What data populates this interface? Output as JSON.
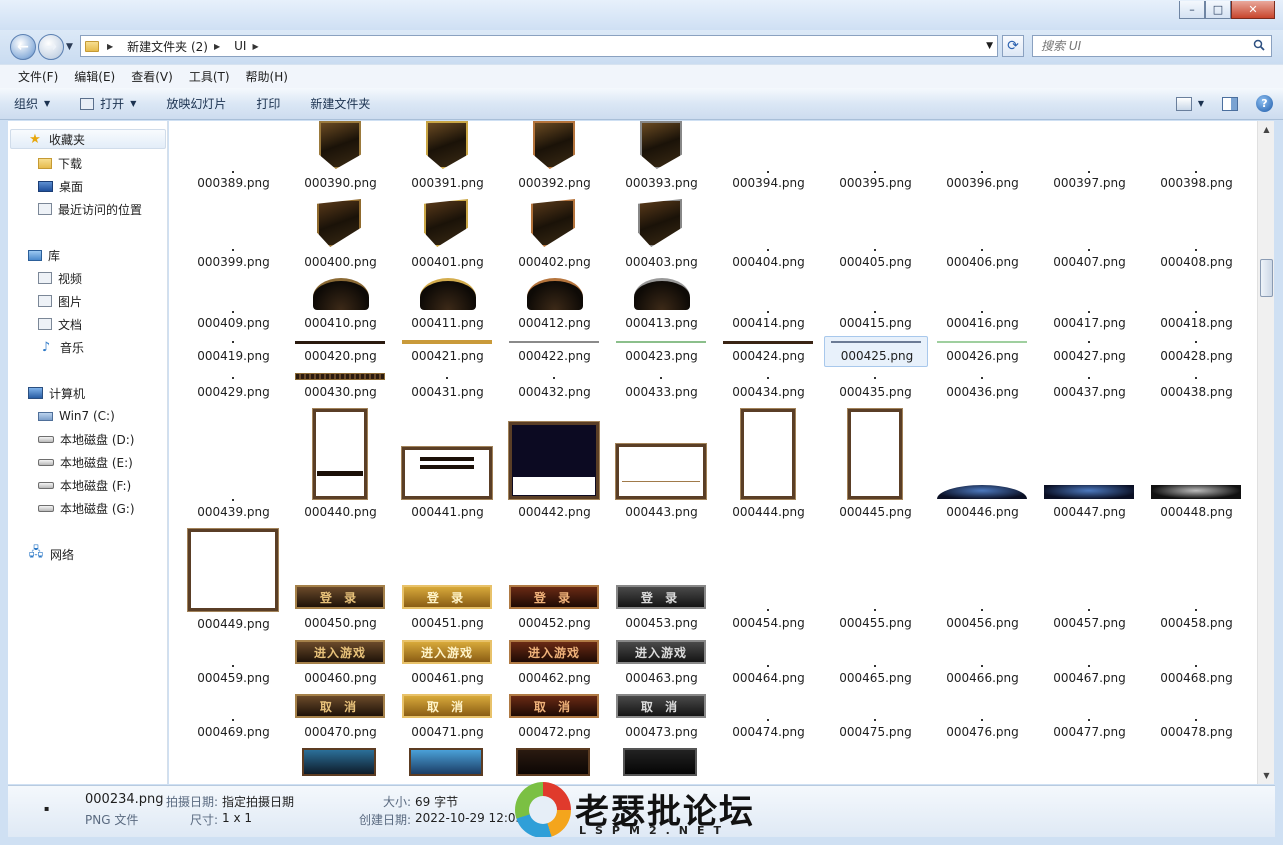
{
  "window": {
    "controls": {
      "minimize": "–",
      "maximize": "□",
      "close": "✕"
    }
  },
  "address": {
    "crumbs": [
      "新建文件夹 (2)",
      "UI"
    ],
    "search_placeholder": "搜索 UI"
  },
  "menu": [
    "文件(F)",
    "编辑(E)",
    "查看(V)",
    "工具(T)",
    "帮助(H)"
  ],
  "commands": {
    "organize": "组织",
    "open": "打开",
    "slideshow": "放映幻灯片",
    "print": "打印",
    "new_folder": "新建文件夹"
  },
  "nav": {
    "favorites": "收藏夹",
    "downloads": "下载",
    "desktop": "桌面",
    "recent": "最近访问的位置",
    "libraries": "库",
    "videos": "视频",
    "pictures": "图片",
    "documents": "文档",
    "music": "音乐",
    "computer": "计算机",
    "drives": [
      "Win7 (C:)",
      "本地磁盘 (D:)",
      "本地磁盘 (E:)",
      "本地磁盘 (F:)",
      "本地磁盘 (G:)"
    ],
    "network": "网络"
  },
  "files": {
    "r389": [
      "000389.png",
      "000390.png",
      "000391.png",
      "000392.png",
      "000393.png",
      "000394.png",
      "000395.png",
      "000396.png",
      "000397.png",
      "000398.png"
    ],
    "r399": [
      "000399.png",
      "000400.png",
      "000401.png",
      "000402.png",
      "000403.png",
      "000404.png",
      "000405.png",
      "000406.png",
      "000407.png",
      "000408.png"
    ],
    "r409": [
      "000409.png",
      "000410.png",
      "000411.png",
      "000412.png",
      "000413.png",
      "000414.png",
      "000415.png",
      "000416.png",
      "000417.png",
      "000418.png"
    ],
    "r419": [
      "000419.png",
      "000420.png",
      "000421.png",
      "000422.png",
      "000423.png",
      "000424.png",
      "000425.png",
      "000426.png",
      "000427.png",
      "000428.png"
    ],
    "r429": [
      "000429.png",
      "000430.png",
      "000431.png",
      "000432.png",
      "000433.png",
      "000434.png",
      "000435.png",
      "000436.png",
      "000437.png",
      "000438.png"
    ],
    "r439": [
      "000439.png",
      "000440.png",
      "000441.png",
      "000442.png",
      "000443.png",
      "000444.png",
      "000445.png",
      "000446.png",
      "000447.png",
      "000448.png"
    ],
    "r449": [
      "000449.png"
    ],
    "r450": [
      "000450.png",
      "000451.png",
      "000452.png",
      "000453.png",
      "000454.png",
      "000455.png",
      "000456.png",
      "000457.png",
      "000458.png"
    ],
    "r459": [
      "000459.png",
      "000460.png",
      "000461.png",
      "000462.png",
      "000463.png",
      "000464.png",
      "000465.png",
      "000466.png",
      "000467.png",
      "000468.png"
    ],
    "r469": [
      "000469.png",
      "000470.png",
      "000471.png",
      "000472.png",
      "000473.png",
      "000474.png",
      "000475.png",
      "000476.png",
      "000477.png",
      "000478.png"
    ]
  },
  "button_labels": {
    "login": "登 录",
    "enter_game": "进入游戏",
    "cancel": "取 消"
  },
  "details": {
    "filename": "000234.png",
    "filetype": "PNG 文件",
    "date_taken_label": "拍摄日期:",
    "date_taken_value": "指定拍摄日期",
    "dimensions_label": "尺寸:",
    "dimensions_value": "1 x 1",
    "size_label": "大小:",
    "size_value": "69 字节",
    "created_label": "创建日期:",
    "created_value": "2022-10-29 12:05"
  },
  "watermark": {
    "title": "老瑟批论坛",
    "url": "LSPM2.NET"
  },
  "colors": {
    "accent": "#cfe0f3",
    "selection": "#e8f1fb"
  }
}
